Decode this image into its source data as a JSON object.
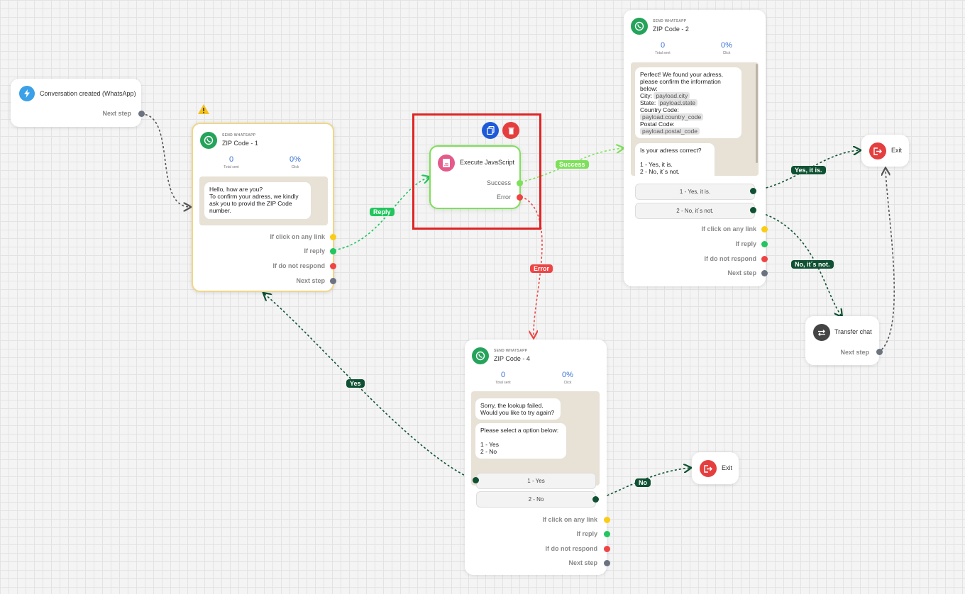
{
  "trigger": {
    "title": "Conversation created (WhatsApp)",
    "next_step": "Next step"
  },
  "zip1": {
    "type_label": "SEND WHATSAPP",
    "name": "ZIP Code - 1",
    "total_sent": "0",
    "total_sent_label": "Total sent",
    "click": "0%",
    "click_label": "Click",
    "message": "Hello, how are you?\nTo confirm your adress, we kindly ask you to provid the ZIP Code number.",
    "ports": [
      "If click on any link",
      "If reply",
      "If do not respond",
      "Next step"
    ]
  },
  "js": {
    "title": "Execute JavaScript",
    "success": "Success",
    "error": "Error",
    "copy_icon": "copy-icon",
    "delete_icon": "trash-icon"
  },
  "zip2": {
    "type_label": "SEND WHATSAPP",
    "name": "ZIP Code - 2",
    "total_sent": "0",
    "total_sent_label": "Total sent",
    "click": "0%",
    "click_label": "Click",
    "message1_intro": "Perfect! We found your adress, please confirm the information below:",
    "city_label": "City:",
    "city_value": "payload.city",
    "state_label": "State:",
    "state_value": "payload.state",
    "country_label": "Country Code:",
    "country_value": "payload.country_code",
    "postal_label": "Postal Code:",
    "postal_value": "payload.postal_code",
    "message2": "Is your adress correct?\n\n1 - Yes, it is.\n2 - No, it´s not.",
    "options": [
      "1 - Yes, it is.",
      "2 - No, it´s not."
    ],
    "ports": [
      "If click on any link",
      "If reply",
      "If do not respond",
      "Next step"
    ]
  },
  "zip4": {
    "type_label": "SEND WHATSAPP",
    "name": "ZIP Code - 4",
    "total_sent": "0",
    "total_sent_label": "Total sent",
    "click": "0%",
    "click_label": "Click",
    "message1": "Sorry, the lookup failed.\nWould you like to try again?",
    "message2": "Please select a option below:\n\n1 - Yes\n2 - No",
    "options": [
      "1 - Yes",
      "2 - No"
    ],
    "ports": [
      "If click on any link",
      "If reply",
      "If do not respond",
      "Next step"
    ]
  },
  "exit_top": {
    "title": "Exit"
  },
  "exit_bottom": {
    "title": "Exit"
  },
  "transfer": {
    "title": "Transfer chat",
    "next_step": "Next step"
  },
  "edge_labels": {
    "reply": "Reply",
    "success": "Success",
    "error": "Error",
    "yes_it_is": "Yes, it is.",
    "no_its_not": "No, it´s not.",
    "yes": "Yes",
    "no": "No"
  },
  "colors": {
    "green": "#22c55e",
    "dark_green": "#0f5132",
    "red": "#ef4444",
    "yellow": "#facc15",
    "grey": "#6b7280",
    "selection": "#e02424"
  }
}
